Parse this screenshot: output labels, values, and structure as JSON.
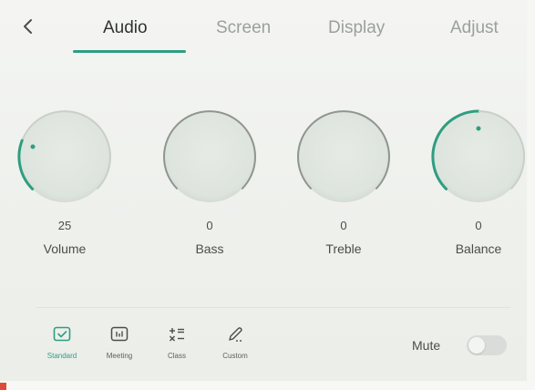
{
  "header": {
    "back_icon": "chevron-left-icon",
    "tabs": [
      {
        "label": "Audio",
        "active": true
      },
      {
        "label": "Screen",
        "active": false
      },
      {
        "label": "Display",
        "active": false
      },
      {
        "label": "Adjust",
        "active": false
      }
    ]
  },
  "knobs": [
    {
      "value": "25",
      "label": "Volume"
    },
    {
      "value": "0",
      "label": "Bass"
    },
    {
      "value": "0",
      "label": "Treble"
    },
    {
      "value": "0",
      "label": "Balance"
    }
  ],
  "modes": [
    {
      "label": "Standard",
      "icon": "check-box-icon",
      "selected": true
    },
    {
      "label": "Meeting",
      "icon": "equalizer-box-icon",
      "selected": false
    },
    {
      "label": "Class",
      "icon": "math-symbols-icon",
      "selected": false
    },
    {
      "label": "Custom",
      "icon": "pen-icon",
      "selected": false
    }
  ],
  "mute": {
    "label": "Mute",
    "on": false
  },
  "colors": {
    "accent": "#2e9e80",
    "text": "#2f3330",
    "muted_text": "#9aa09b",
    "background": "#f1f3f0"
  }
}
